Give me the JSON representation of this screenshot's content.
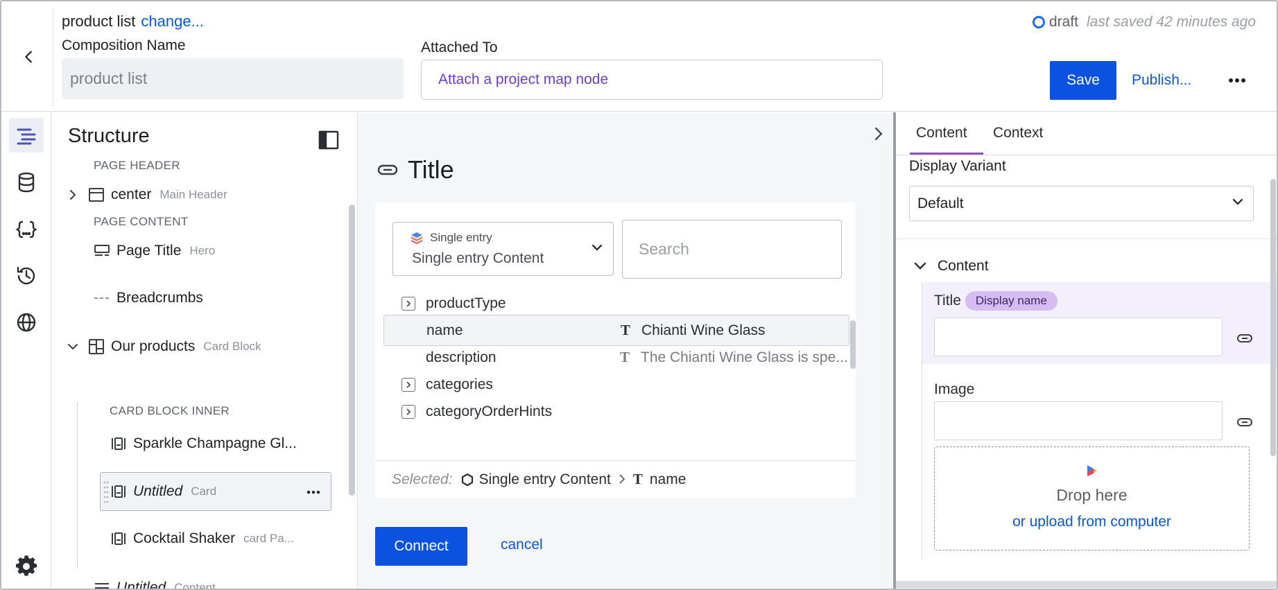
{
  "header": {
    "composition_line": "product list",
    "change_link": "change...",
    "name_label": "Composition Name",
    "name_value": "product list",
    "attach_label": "Attached To",
    "attach_placeholder": "Attach a project map node",
    "status_draft": "draft",
    "status_saved": "last saved 42 minutes ago",
    "save_label": "Save",
    "publish_label": "Publish...",
    "more_icon": "more-horizontal-icon"
  },
  "rail": {
    "items": [
      "structure-icon",
      "database-icon",
      "json-braces-icon",
      "history-icon",
      "globe-icon",
      "settings-icon"
    ]
  },
  "structure": {
    "title": "Structure",
    "page_header_label": "PAGE HEADER",
    "center_title": "center",
    "center_sub": "Main Header",
    "page_content_label": "PAGE CONTENT",
    "page_title": "Page Title",
    "page_title_sub": "Hero",
    "breadcrumbs_title": "Breadcrumbs",
    "products_title": "Our products",
    "products_sub": "Card Block",
    "card_block_inner_label": "CARD BLOCK INNER",
    "card1_title": "Sparkle Champagne Gl...",
    "card2_title": "Untitled",
    "card2_sub": "Card",
    "card3_title": "Cocktail Shaker",
    "card3_sub": "card Pa...",
    "cut_title": "Untitled",
    "cut_sub": "Content"
  },
  "editor": {
    "title": "Title",
    "entry_small": "Single entry",
    "entry_big": "Single entry Content",
    "search_placeholder": "Search",
    "fields": [
      {
        "name": "productType",
        "expandable": true,
        "value": ""
      },
      {
        "name": "name",
        "expandable": false,
        "value": "Chianti Wine Glass"
      },
      {
        "name": "description",
        "expandable": false,
        "value": "The Chianti Wine Glass is spe..."
      },
      {
        "name": "categories",
        "expandable": true,
        "value": ""
      },
      {
        "name": "categoryOrderHints",
        "expandable": true,
        "value": ""
      }
    ],
    "selected_label": "Selected:",
    "selected_entry": "Single entry Content",
    "selected_field": "name",
    "connect_label": "Connect",
    "cancel_label": "cancel"
  },
  "props": {
    "tab_content": "Content",
    "tab_context": "Context",
    "display_variant_label": "Display Variant",
    "display_variant_value": "Default",
    "content_heading": "Content",
    "title_label": "Title",
    "title_badge": "Display name",
    "image_label": "Image",
    "drop_title": "Drop here",
    "drop_link": "or upload from computer"
  },
  "colors": {
    "primary": "#0b52e0",
    "link": "#0a57d6",
    "accent_purple": "#8a4fd8",
    "badge_purple": "#d5bdf3",
    "rail_active": "#4b4fbf"
  }
}
